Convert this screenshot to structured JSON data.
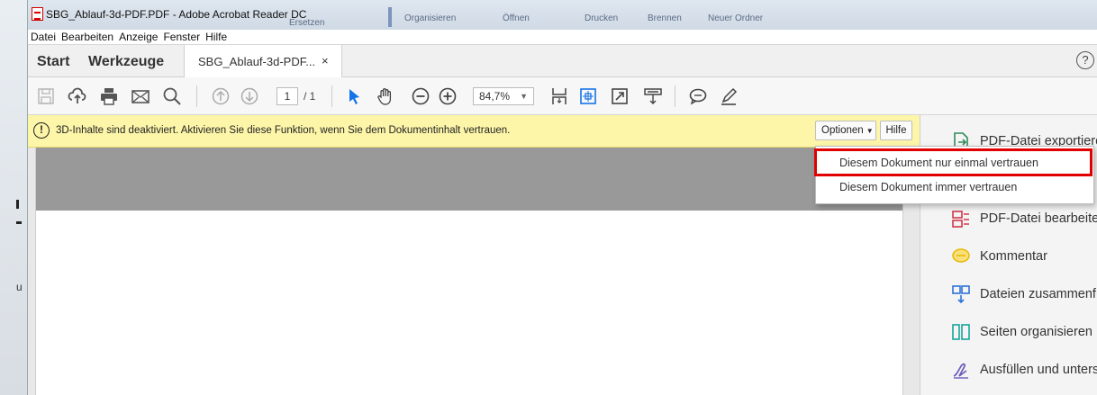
{
  "window": {
    "title": "SBG_Ablauf-3d-PDF.PDF - Adobe Acrobat Reader DC",
    "background_items": [
      "Organisieren",
      "Öffnen",
      "Drucken",
      "Brennen",
      "Neuer Ordner",
      "Ersetzen"
    ]
  },
  "menu": [
    "Datei",
    "Bearbeiten",
    "Anzeige",
    "Fenster",
    "Hilfe"
  ],
  "tabs": {
    "start": "Start",
    "tools": "Werkzeuge",
    "document": "SBG_Ablauf-3d-PDF...",
    "close": "×",
    "help": "?"
  },
  "toolbar": {
    "page_current": "1",
    "page_total": "/ 1",
    "zoom": "84,7%",
    "icons": [
      "save-icon",
      "upload-icon",
      "print-icon",
      "email-icon",
      "search-icon",
      "previous-page-icon",
      "next-page-icon",
      "select-arrow-icon",
      "hand-icon",
      "zoom-out-icon",
      "zoom-in-icon",
      "fit-page-icon",
      "rotate-icon",
      "fullscreen-icon",
      "read-mode-icon",
      "comment-icon",
      "highlight-icon"
    ]
  },
  "notice": {
    "message": "3D-Inhalte sind deaktiviert. Aktivieren Sie diese Funktion, wenn Sie dem Dokumentinhalt vertrauen.",
    "options_label": "Optionen",
    "help_label": "Hilfe"
  },
  "dropdown": {
    "items": [
      "Diesem Dokument nur einmal vertrauen",
      "Diesem Dokument immer vertrauen"
    ],
    "highlight_color": "#e00000"
  },
  "right_panel": {
    "items": [
      "PDF-Datei exportieren",
      "PDF-Datei bearbeiten",
      "Kommentar",
      "Dateien zusammenführen",
      "Seiten organisieren",
      "Ausfüllen und unterschreiben"
    ]
  },
  "colors": {
    "accent": "#1473e6",
    "notice_bg": "#fdf6a9",
    "doc_gray": "#999999"
  }
}
